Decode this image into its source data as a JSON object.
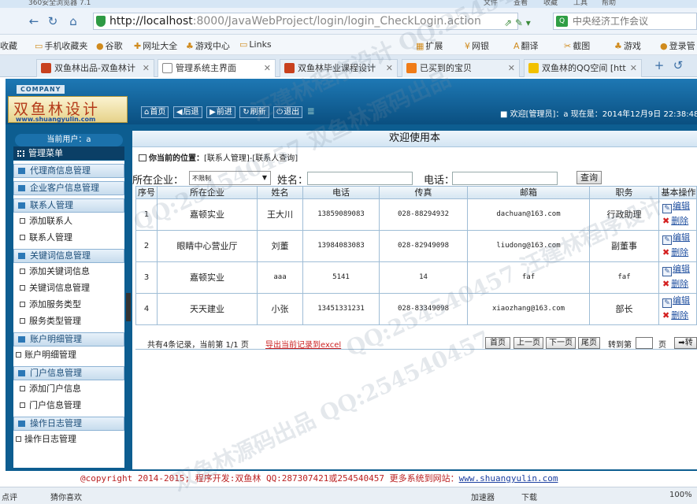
{
  "browser": {
    "title": "360安全浏览器 7.1",
    "title_menus": [
      "文件",
      "查看",
      "收藏",
      "工具",
      "帮助"
    ],
    "url_host": "http://localhost",
    "url_path": ":8000/JavaWebProject/login/login_CheckLogin.action",
    "search_text": "中央经济工作会议",
    "favorites": [
      "收藏",
      "手机收藏夹",
      "谷歌",
      "网址大全",
      "游戏中心",
      "Links",
      "扩展",
      "网银",
      "翻译",
      "截图",
      "游戏",
      "登录管"
    ],
    "tabs": [
      "双鱼林出品-双鱼林计",
      "管理系统主界面",
      "双鱼林毕业课程设计",
      "已买到的宝贝",
      "双鱼林的QQ空间 [htt"
    ]
  },
  "app": {
    "company": "COMPANY",
    "logo_text": "双鱼林设计",
    "logo_url": "www.shuangyulin.com",
    "nav": [
      {
        "icon": "home-icon",
        "glyph": "⌂",
        "label": "首页"
      },
      {
        "icon": "back-icon",
        "glyph": "◀",
        "label": "后退"
      },
      {
        "icon": "forward-icon",
        "glyph": "▶",
        "label": "前进"
      },
      {
        "icon": "refresh-icon",
        "glyph": "↻",
        "label": "刷新"
      },
      {
        "icon": "power-icon",
        "glyph": "⏻",
        "label": "退出"
      }
    ],
    "welcome": "■ 欢迎[管理员]：a  现在是：2014年12月9日 22:38:48",
    "user_panel": "当前用户：a"
  },
  "sidebar": {
    "active": "管理菜单",
    "groups": [
      {
        "label": "代理商信息管理",
        "items": []
      },
      {
        "label": "企业客户信息管理",
        "items": []
      },
      {
        "label": "联系人管理",
        "items": [
          "添加联系人",
          "联系人管理"
        ]
      },
      {
        "label": "关键词信息管理",
        "items": [
          "添加关键词信息",
          "关键词信息管理",
          "添加服务类型",
          "服务类型管理"
        ]
      },
      {
        "label": "账户明细管理",
        "items": [
          "账户明细管理"
        ]
      },
      {
        "label": "门户信息管理",
        "items": [
          "添加门户信息",
          "门户信息管理"
        ]
      },
      {
        "label": "操作日志管理",
        "items": [
          "操作日志管理"
        ]
      }
    ]
  },
  "main": {
    "title": "欢迎使用本",
    "location_label": "你当前的位置：",
    "location_path": "[联系人管理]-[联系人查询]",
    "search": {
      "company_label": "所在企业：",
      "company_value": "不限制",
      "name_label": "姓名：",
      "phone_label": "电话：",
      "query_button": "查询"
    },
    "columns": [
      "序号",
      "所在企业",
      "姓名",
      "电话",
      "传真",
      "邮箱",
      "职务",
      "基本操作"
    ],
    "rows": [
      [
        "1",
        "嘉顿实业",
        "王大川",
        "13859089083",
        "028-88294932",
        "dachuan@163.com",
        "行政助理"
      ],
      [
        "2",
        "眼睛中心营业厅",
        "刘董",
        "13984083083",
        "028-82949098",
        "liudong@163.com",
        "副董事"
      ],
      [
        "3",
        "嘉顿实业",
        "aaa",
        "5141",
        "14",
        "faf",
        "faf"
      ],
      [
        "4",
        "天天建业",
        "小张",
        "13451331231",
        "028-83349098",
        "xiaozhang@163.com",
        "部长"
      ]
    ],
    "op_edit": "编辑",
    "op_delete": "删除",
    "pager": {
      "info": "共有4条记录，当前第 1/1 页",
      "export": "导出当前记录到excel",
      "buttons": [
        "首页",
        "上一页",
        "下一页",
        "尾页"
      ],
      "jump_label": "转到第",
      "page_label": "页",
      "go_button": "转"
    }
  },
  "footer": {
    "text": "@copyright 2014-2015; 程序开发:双鱼林  QQ:287307421或254540457  更多系统到网站：",
    "link": "www.shuangyulin.com"
  },
  "statusbar": {
    "items": [
      "点评",
      "猜你喜欢",
      "加速器",
      "下载",
      "100%"
    ]
  }
}
